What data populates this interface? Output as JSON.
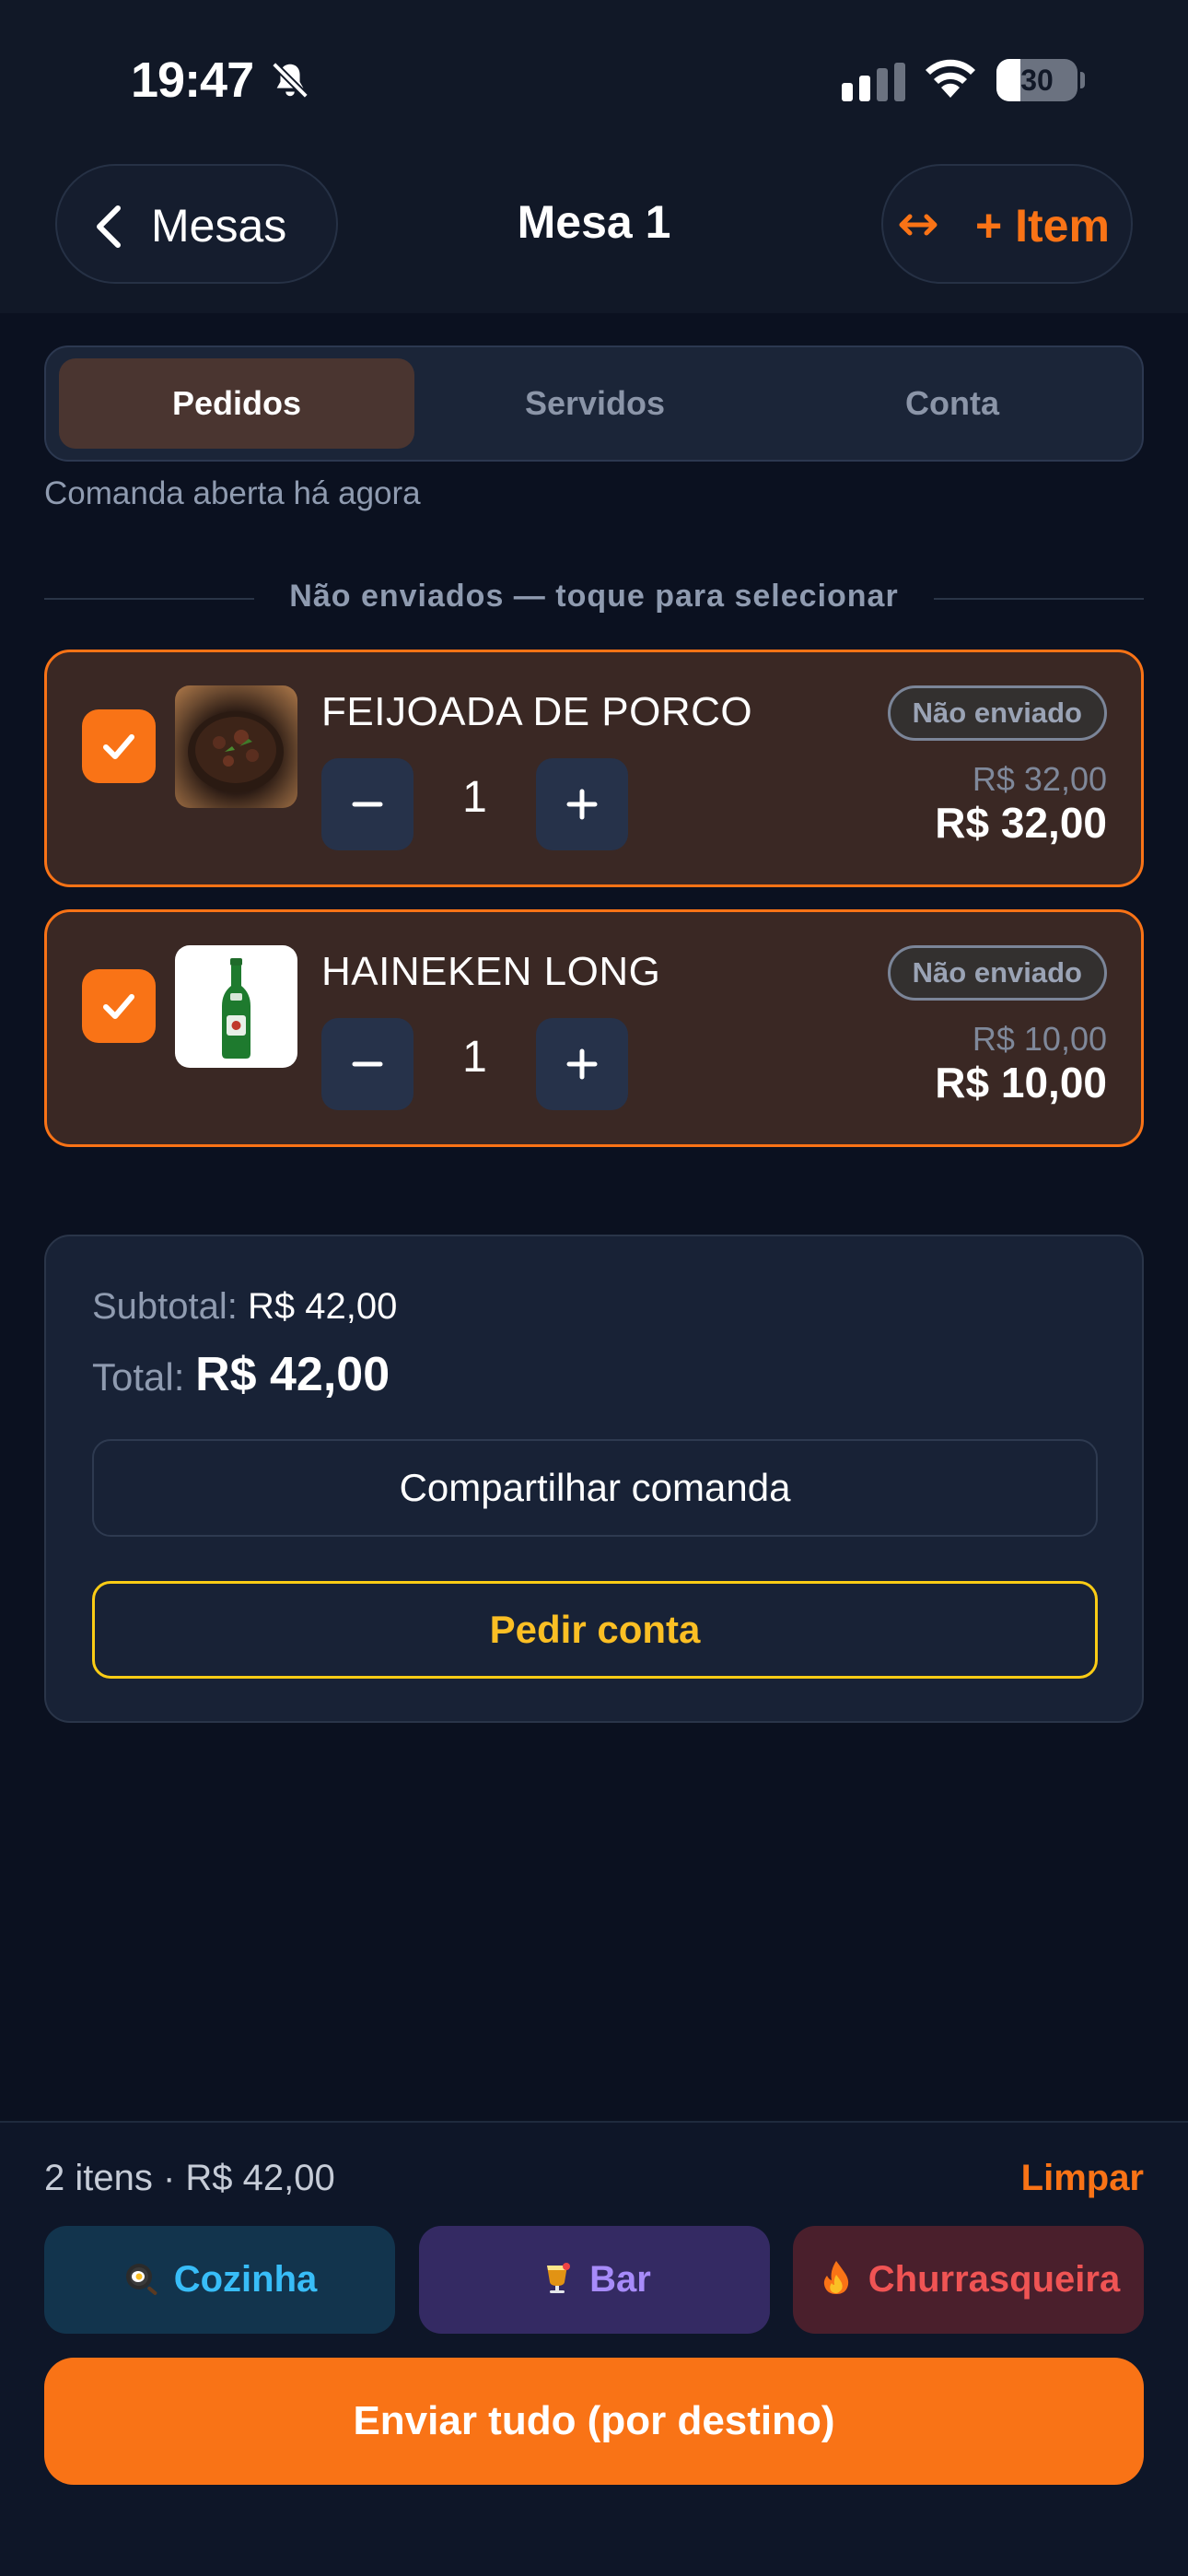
{
  "status_bar": {
    "time": "19:47",
    "battery": "30",
    "battery_level": 0.3
  },
  "header": {
    "back_label": "Mesas",
    "title": "Mesa 1",
    "add_item_label": "+ Item"
  },
  "tabs": [
    {
      "label": "Pedidos",
      "active": true
    },
    {
      "label": "Servidos",
      "active": false
    },
    {
      "label": "Conta",
      "active": false
    }
  ],
  "open_note": "Comanda aberta há agora",
  "section_label": "Não enviados — toque para selecionar",
  "items": [
    {
      "name": "FEIJOADA DE PORCO",
      "quantity": "1",
      "status": "Não enviado",
      "unit_price": "R$ 32,00",
      "total": "R$ 32,00",
      "selected": true,
      "image": "feijoada-photo"
    },
    {
      "name": "HAINEKEN LONG",
      "quantity": "1",
      "status": "Não enviado",
      "unit_price": "R$ 10,00",
      "total": "R$ 10,00",
      "selected": true,
      "image": "beer-bottle-photo"
    }
  ],
  "summary": {
    "subtotal_label": "Subtotal:",
    "subtotal_value": "R$ 42,00",
    "total_label": "Total:",
    "total_value": "R$ 42,00",
    "share_label": "Compartilhar comanda",
    "bill_label": "Pedir conta"
  },
  "bottom": {
    "summary": "2 itens · R$ 42,00",
    "clear_label": "Limpar",
    "destinations": [
      {
        "label": "Cozinha",
        "icon": "frying-pan-icon",
        "color": "#38bdf8"
      },
      {
        "label": "Bar",
        "icon": "cocktail-icon",
        "color": "#a78bfa"
      },
      {
        "label": "Churrasqueira",
        "icon": "fire-icon",
        "color": "#f05454"
      }
    ],
    "send_label": "Enviar tudo (por destino)"
  },
  "colors": {
    "accent": "#f97316",
    "background": "#0b1120",
    "card": "#182236",
    "warning": "#facc15"
  }
}
